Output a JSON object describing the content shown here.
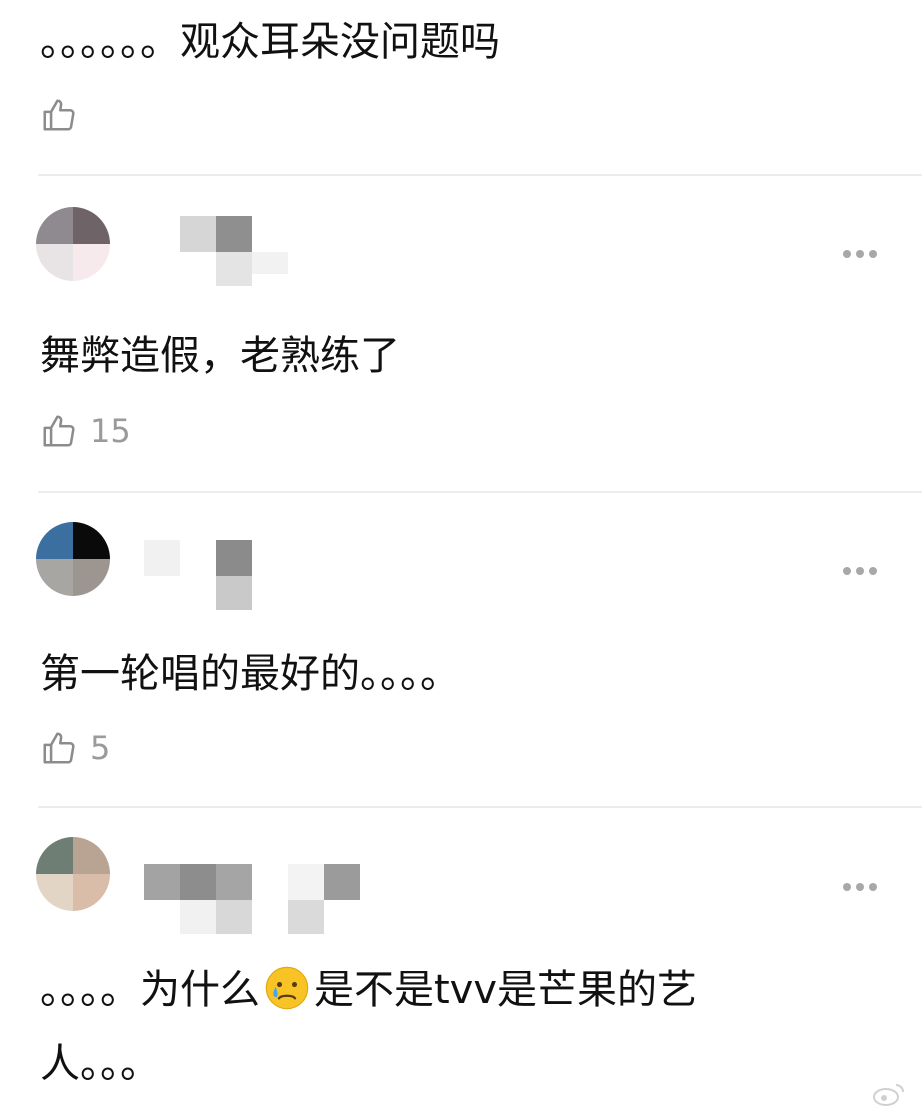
{
  "comments": [
    {
      "text": "。。。。。。观众耳朵没问题吗",
      "likes": ""
    },
    {
      "text": "舞弊造假，老熟练了",
      "likes": "15"
    },
    {
      "text": "第一轮唱的最好的。。。。",
      "likes": "5"
    },
    {
      "text_part1": "。。。。为什么",
      "text_part2": "是不是tvv是芒果的艺",
      "text_line2": "人。。。",
      "likes": ""
    }
  ],
  "icons": {
    "like": "thumbs-up-icon",
    "more": "more-dots-icon",
    "emoji": "crying-face-emoji"
  },
  "colors": {
    "text": "#111111",
    "meta": "#9a9a9a",
    "divider": "#ececec"
  },
  "watermark": {
    "text": ""
  }
}
